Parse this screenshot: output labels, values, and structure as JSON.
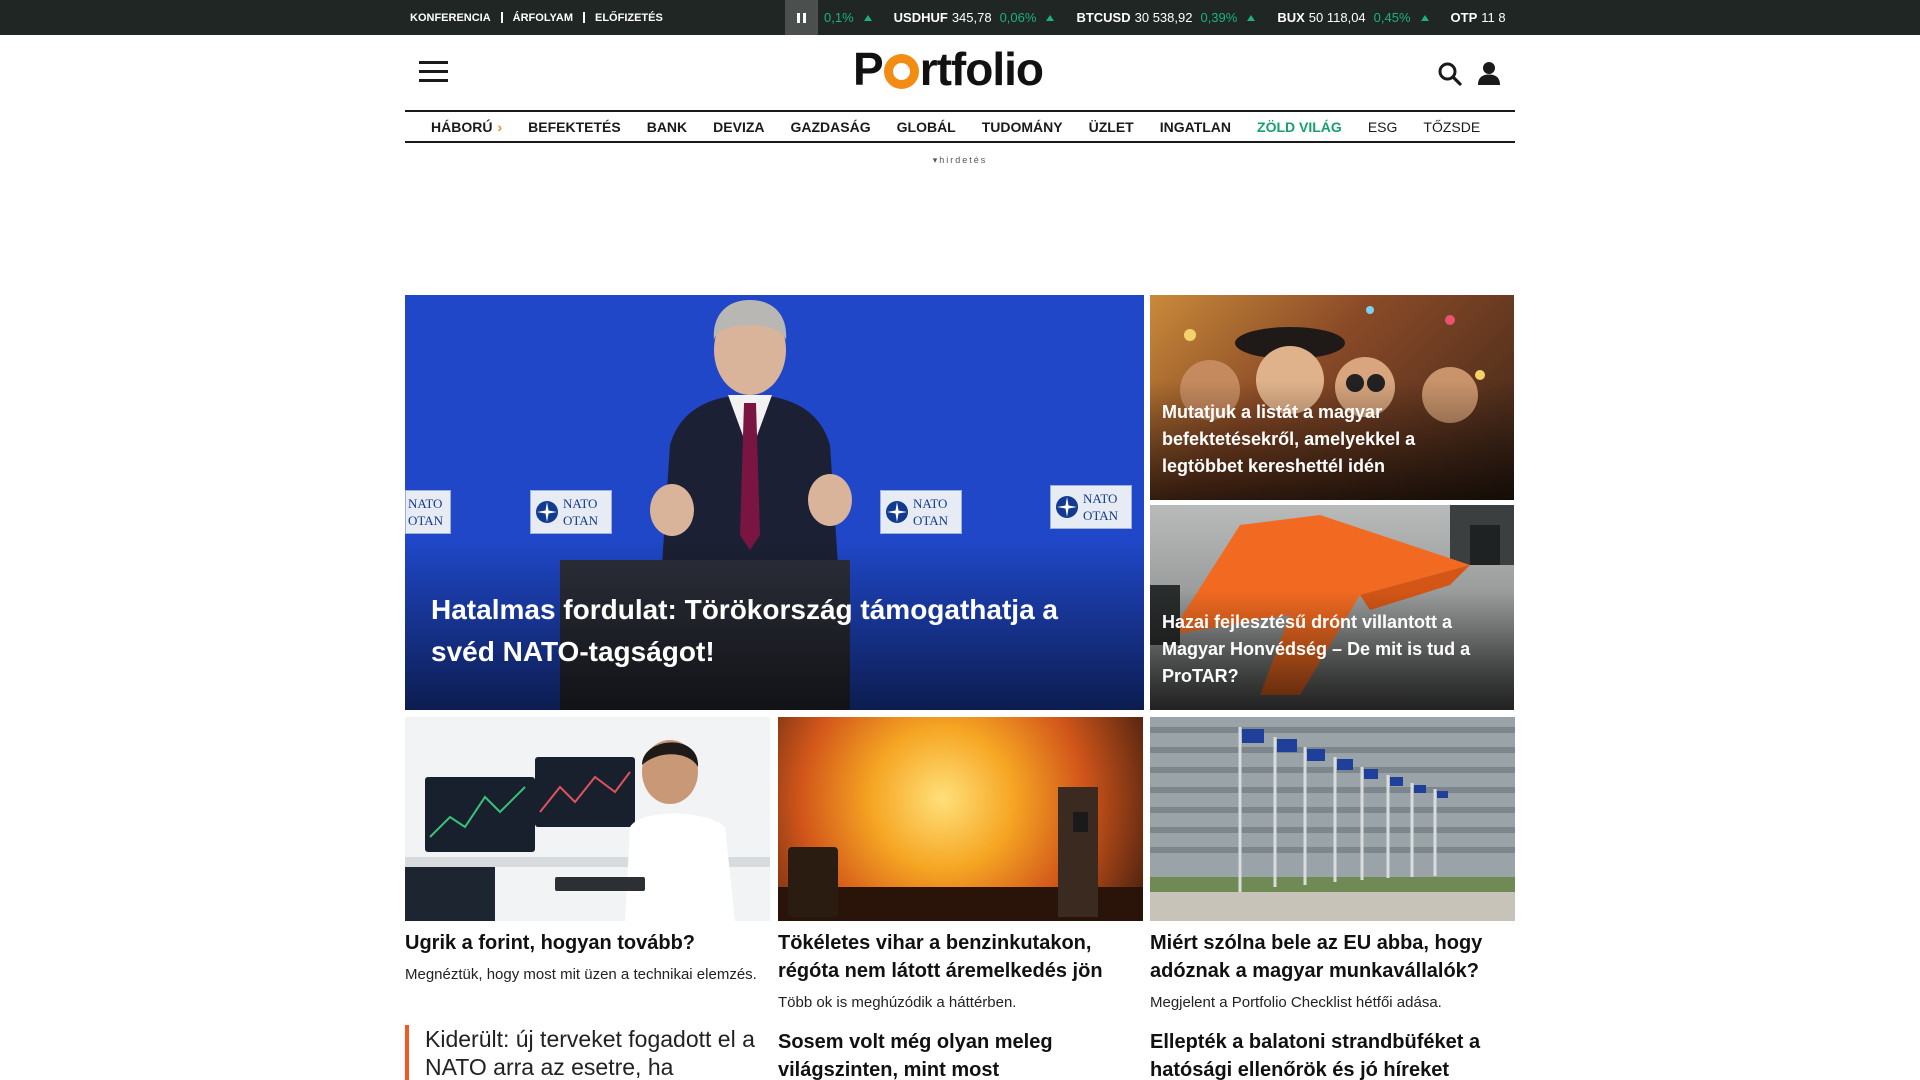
{
  "toplinks": [
    "KONFERENCIA",
    "ÁRFOLYAM",
    "ELŐFIZETÉS"
  ],
  "ticker": [
    {
      "symbol": "",
      "value": "",
      "change": "0,1%"
    },
    {
      "symbol": "USDHUF",
      "value": "345,78",
      "change": "0,06%"
    },
    {
      "symbol": "BTCUSD",
      "value": "30 538,92",
      "change": "0,39%"
    },
    {
      "symbol": "BUX",
      "value": "50 118,04",
      "change": "0,45%"
    },
    {
      "symbol": "OTP",
      "value": "11 8",
      "change": ""
    }
  ],
  "logo": {
    "left": "P",
    "right": "rtfolio",
    "accent": "#f28c12"
  },
  "nav": [
    {
      "label": "HÁBORÚ",
      "style": "bold",
      "arrow": true
    },
    {
      "label": "BEFEKTETÉS",
      "style": "bold"
    },
    {
      "label": "BANK",
      "style": "bold"
    },
    {
      "label": "DEVIZA",
      "style": "bold"
    },
    {
      "label": "GAZDASÁG",
      "style": "bold"
    },
    {
      "label": "GLOBÁL",
      "style": "bold"
    },
    {
      "label": "TUDOMÁNY",
      "style": "bold"
    },
    {
      "label": "ÜZLET",
      "style": "bold"
    },
    {
      "label": "INGATLAN",
      "style": "bold"
    },
    {
      "label": "ZÖLD VILÁG",
      "style": "green"
    },
    {
      "label": "ESG",
      "style": "light"
    },
    {
      "label": "TŐZSDE",
      "style": "light"
    }
  ],
  "ad_label": "hirdetés",
  "hero": {
    "title": "Hatalmas fordulat: Törökország támogathatja a svéd NATO-tagságot!",
    "sign_text": [
      "NATO",
      "OTAN"
    ]
  },
  "side_articles": [
    {
      "title": "Mutatjuk a listát a magyar befektetésekről, amelyekkel a legtöbbet kereshettél idén"
    },
    {
      "title": "Hazai fejlesztésű drónt villantott a Magyar Honvédség – De mit is tud a ProTAR?"
    }
  ],
  "cards": [
    {
      "title": "Ugrik a forint, hogyan tovább?",
      "lead": "Megnéztük, hogy most mit üzen a technikai elemzés."
    },
    {
      "title": "Tökéletes vihar a benzinkutakon, régóta nem látott áremelkedés jön",
      "lead": "Több ok is meghúzódik a háttérben."
    },
    {
      "title": "Miért szólna bele az EU abba, hogy adóznak a magyar munkavállalók?",
      "lead": "Megjelent a Portfolio Checklist hétfői adása."
    }
  ],
  "bottom": {
    "quote": "Kiderült: új terveket fogadott el a NATO arra az esetre, ha",
    "mid": "Sosem volt még olyan meleg világszinten, mint most",
    "right": "Ellepték a balatoni strandbüféket a hatósági ellenőrök és jó híreket közöltek"
  },
  "colors": {
    "topbar": "#1f2623",
    "up": "#1cb083",
    "green_nav": "#16a06a",
    "accent": "#f28c12",
    "quote_bar": "#f05a22"
  }
}
